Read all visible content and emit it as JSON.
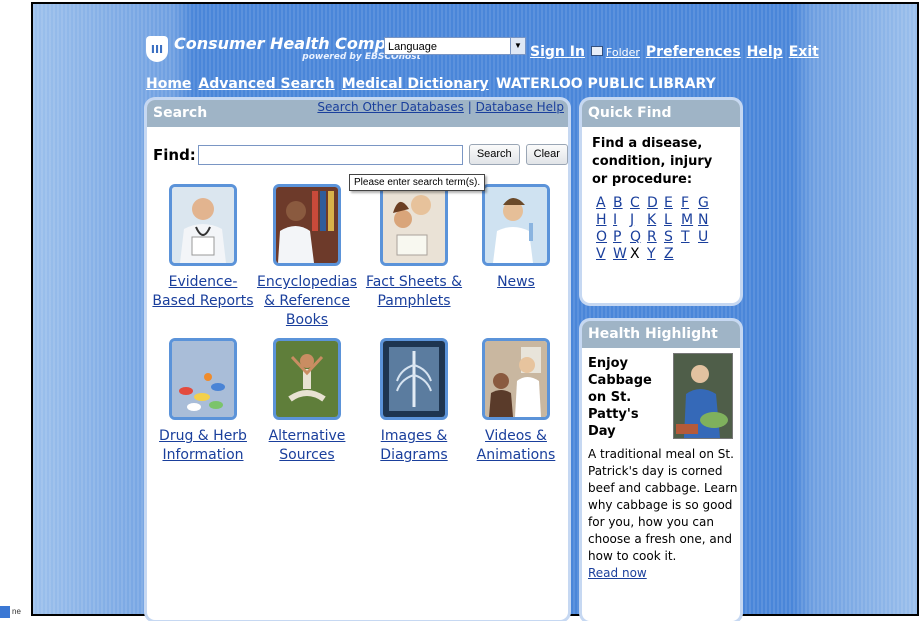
{
  "header": {
    "brand_title": "Consumer Health Complete",
    "brand_sub": "powered by EBSCOhost",
    "logo_letter": "III",
    "language_select": "Language",
    "sign_in": "Sign In",
    "folder": "Folder",
    "preferences": "Preferences",
    "help": "Help",
    "exit": "Exit"
  },
  "nav": {
    "home": "Home",
    "advanced_search": "Advanced Search",
    "medical_dictionary": "Medical Dictionary",
    "library": "WATERLOO PUBLIC LIBRARY"
  },
  "search_panel": {
    "title": "Search",
    "other_db": "Search Other Databases",
    "sep": "|",
    "db_help": "Database Help",
    "find_label": "Find:",
    "search_btn": "Search",
    "clear_btn": "Clear",
    "tooltip": "Please enter search term(s)."
  },
  "tiles": [
    {
      "line1": "Evidence-",
      "line2": "Based Reports",
      "line3": ""
    },
    {
      "line1": "Encyclopedias",
      "line2": "& Reference",
      "line3": "Books"
    },
    {
      "line1": "Fact Sheets &",
      "line2": "Pamphlets",
      "line3": ""
    },
    {
      "line1": "News",
      "line2": "",
      "line3": ""
    },
    {
      "line1": "Drug & Herb",
      "line2": "Information",
      "line3": ""
    },
    {
      "line1": "Alternative",
      "line2": "Sources",
      "line3": ""
    },
    {
      "line1": "Images &",
      "line2": "Diagrams",
      "line3": ""
    },
    {
      "line1": "Videos &",
      "line2": "Animations",
      "line3": ""
    }
  ],
  "quick_find": {
    "title": "Quick Find",
    "intro": "Find a disease, condition, injury or procedure:",
    "letters": [
      "A",
      "B",
      "C",
      "D",
      "E",
      "F",
      "G",
      "H",
      "I",
      "J",
      "K",
      "L",
      "M",
      "N",
      "O",
      "P",
      "Q",
      "R",
      "S",
      "T",
      "U",
      "V",
      "W",
      "X",
      "Y",
      "Z"
    ]
  },
  "health_highlight": {
    "title": "Health Highlight",
    "headline": "Enjoy Cabbage on St. Patty's Day",
    "body": "A traditional meal on St. Patrick's day is corned beef and cabbage. Learn why cabbage is so good for you, how you can choose a fresh one, and how to cook it.",
    "read_now": "Read now"
  },
  "taskbar": {
    "label": "ne"
  }
}
